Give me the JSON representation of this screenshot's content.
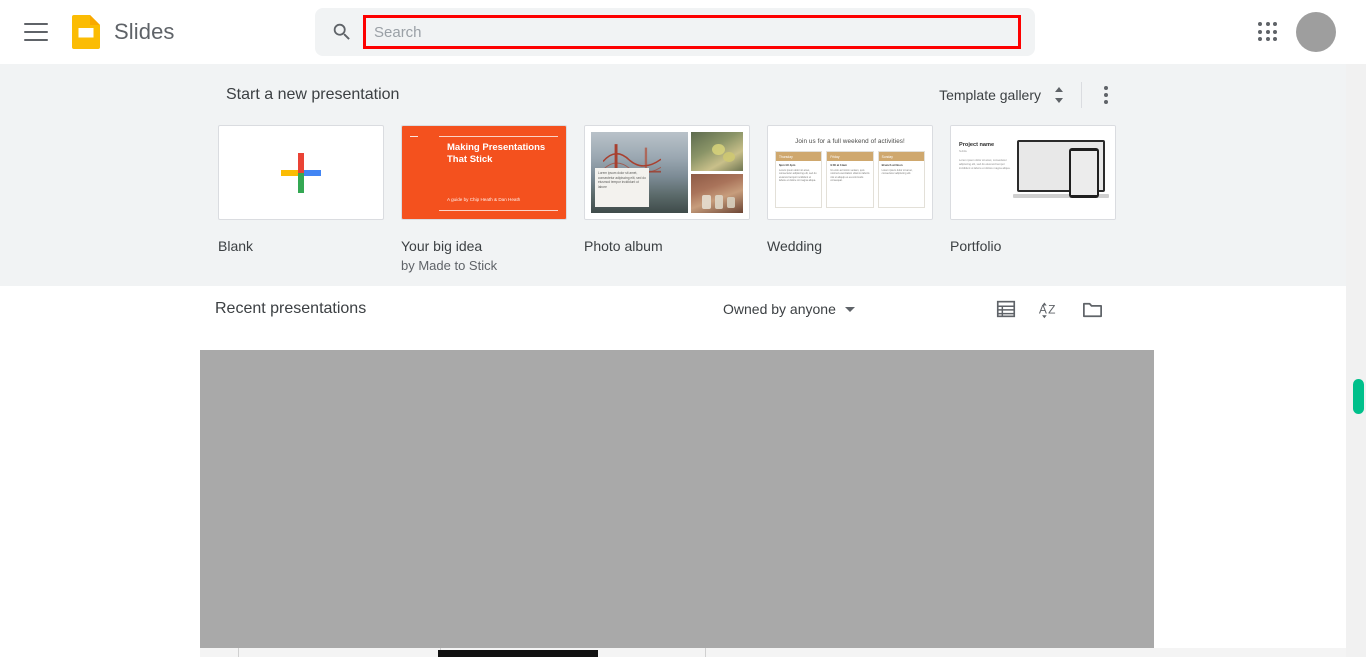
{
  "header": {
    "menu_icon": "hamburger-menu-icon",
    "logo_icon": "google-slides-logo",
    "brand": "Slides",
    "search": {
      "icon": "search-icon",
      "placeholder": "Search",
      "value": "",
      "highlight_color": "#fd0000"
    },
    "apps_icon": "apps-grid-icon",
    "avatar": "user-avatar"
  },
  "templates_section": {
    "title": "Start a new presentation",
    "gallery_label": "Template gallery",
    "gallery_toggle_icon": "chevron-up-down-icon",
    "more_icon": "kebab-menu-icon",
    "background_color": "#f1f3f4",
    "items": [
      {
        "label": "Blank",
        "sublabel": "",
        "thumb": "blank-plus"
      },
      {
        "label": "Your big idea",
        "sublabel": "by Made to Stick",
        "thumb": "your-big-idea",
        "accent_color": "#f4511e",
        "slide_title": "Making Presentations That Stick",
        "slide_byline": "A guide by Chip Heath & Dan Heath"
      },
      {
        "label": "Photo album",
        "sublabel": "",
        "thumb": "photo-album",
        "caption_text": "Lorem ipsum dolor sit amet, consectetur adipiscing elit, sed do eiusmod tempor incididunt ut labore"
      },
      {
        "label": "Wedding",
        "sublabel": "",
        "thumb": "wedding",
        "slide_title": "Join us for a full weekend of activities!",
        "accent_color": "#cfa86e",
        "columns": [
          {
            "day": "Thursday",
            "heading": "6pm till 4pm",
            "body": "Lorem ipsum dolor sit amet, consectetur adipiscing elit, sed do eiusmod tempor incididunt ut labore et dolore sit magna aliqua."
          },
          {
            "day": "Friday",
            "heading": "9:30 at 11am",
            "body": "Ut enim ad minim veniam, quis nostrud exercitation ullamco laboris nisi ut aliquip ex ea commodo consequat."
          },
          {
            "day": "Sunday",
            "heading": "Brunch at Noon",
            "body": "Lorem ipsum dolor sit amet, consectetur adipiscing elit."
          }
        ]
      },
      {
        "label": "Portfolio",
        "sublabel": "",
        "thumb": "portfolio",
        "slide_title": "Project name",
        "slide_sub": "Subtitle",
        "body_text": "Lorem ipsum dolor sit amet, consectetur adipiscing elit, sed do eiusmod tempor incididunt ut labore et dolore magna aliqua."
      }
    ]
  },
  "recent_section": {
    "title": "Recent presentations",
    "owner_filter": "Owned by anyone",
    "owner_caret_icon": "caret-down-icon",
    "list_view_icon": "list-view-icon",
    "sort_icon": "sort-az-icon",
    "folder_icon": "folder-icon",
    "grid_placeholder_color": "#a9a9a9"
  },
  "scrollbars": {
    "vertical_thumb_color": "#00c08b",
    "horizontal_thumb_color": "#111111"
  }
}
